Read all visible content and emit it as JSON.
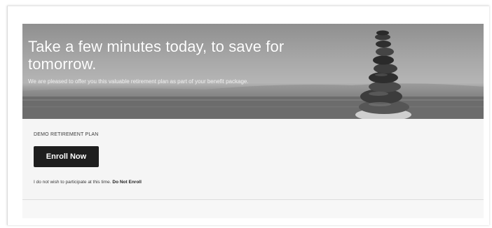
{
  "hero": {
    "title": "Take a few minutes today, to save for tomorrow.",
    "subtitle": "We are pleased to offer you this valuable retirement plan as part of your benefit package.",
    "image_icon": "stacked-stones-image"
  },
  "plan": {
    "name": "DEMO RETIREMENT PLAN",
    "enroll_label": "Enroll Now"
  },
  "optout": {
    "text": "I do not wish to participate at this time.",
    "link_label": "Do Not Enroll"
  },
  "colors": {
    "button": "#1e1e1e",
    "panel": "#f5f5f5"
  }
}
